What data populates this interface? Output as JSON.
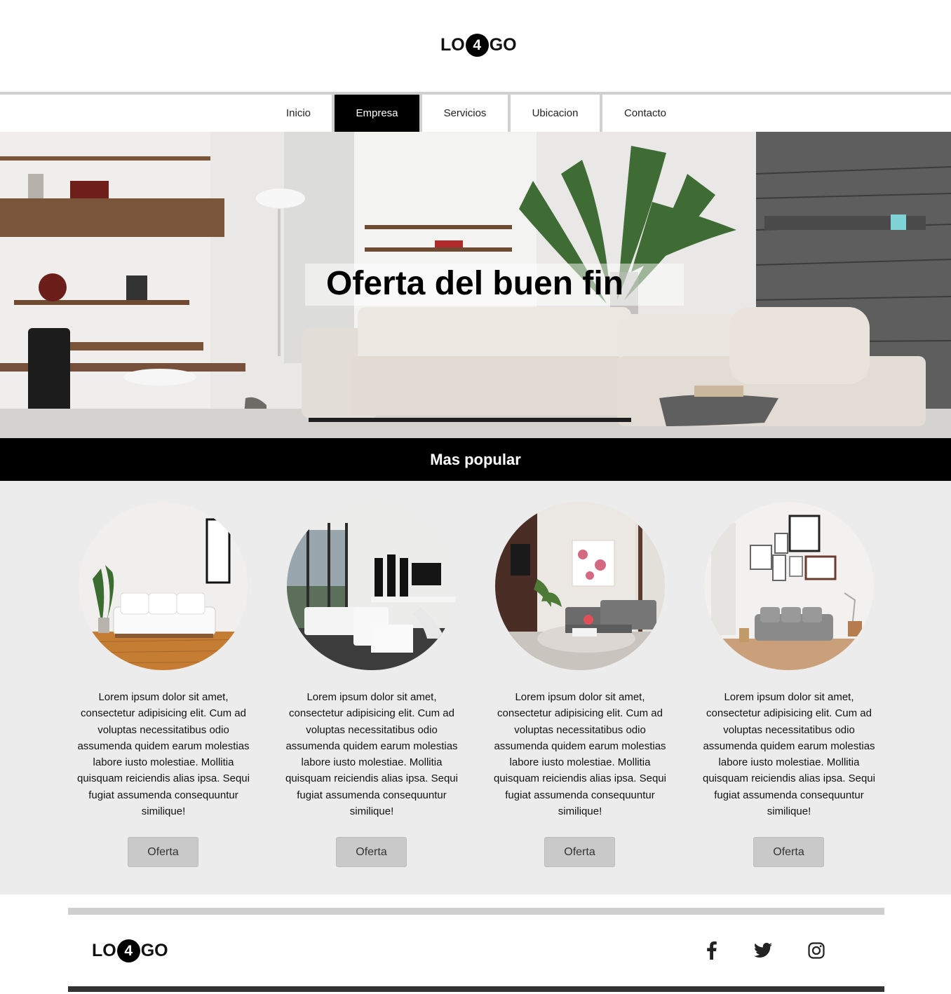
{
  "header": {
    "logo": {
      "left": "LO",
      "number": "4",
      "right": "GO"
    }
  },
  "nav": {
    "items": [
      {
        "label": "Inicio",
        "active": false
      },
      {
        "label": "Empresa",
        "active": true
      },
      {
        "label": "Servicios",
        "active": false
      },
      {
        "label": "Ubicacion",
        "active": false
      },
      {
        "label": "Contacto",
        "active": false
      }
    ]
  },
  "hero": {
    "title": "Oferta del buen fin"
  },
  "popular": {
    "title": "Mas popular",
    "cards": [
      {
        "text": "Lorem ipsum dolor sit amet, consectetur adipisicing elit. Cum ad voluptas necessitatibus odio assumenda quidem earum molestias labore iusto molestiae. Mollitia quisquam reiciendis alias ipsa. Sequi fugiat assumenda consequuntur similique!",
        "button": "Oferta"
      },
      {
        "text": "Lorem ipsum dolor sit amet, consectetur adipisicing elit. Cum ad voluptas necessitatibus odio assumenda quidem earum molestias labore iusto molestiae. Mollitia quisquam reiciendis alias ipsa. Sequi fugiat assumenda consequuntur similique!",
        "button": "Oferta"
      },
      {
        "text": "Lorem ipsum dolor sit amet, consectetur adipisicing elit. Cum ad voluptas necessitatibus odio assumenda quidem earum molestias labore iusto molestiae. Mollitia quisquam reiciendis alias ipsa. Sequi fugiat assumenda consequuntur similique!",
        "button": "Oferta"
      },
      {
        "text": "Lorem ipsum dolor sit amet, consectetur adipisicing elit. Cum ad voluptas necessitatibus odio assumenda quidem earum molestias labore iusto molestiae. Mollitia quisquam reiciendis alias ipsa. Sequi fugiat assumenda consequuntur similique!",
        "button": "Oferta"
      }
    ]
  },
  "footer": {
    "logo": {
      "left": "LO",
      "number": "4",
      "right": "GO"
    },
    "social_icons": [
      "facebook-icon",
      "twitter-icon",
      "instagram-icon"
    ]
  },
  "colors": {
    "accent": "#000000",
    "nav_separator": "#d0d0d0",
    "section_background": "#ececec",
    "button_background": "#c9c9c9"
  }
}
